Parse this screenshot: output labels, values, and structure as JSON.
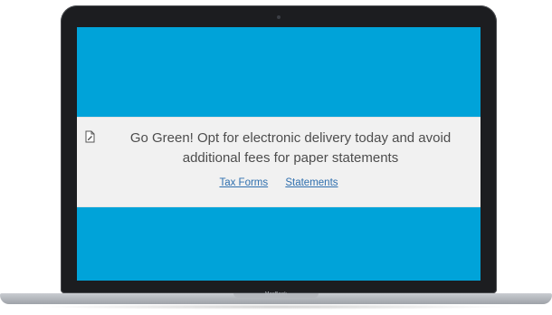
{
  "device": {
    "brand_label": "MacBook"
  },
  "banner": {
    "icon": "document-edit-icon",
    "message": "Go Green! Opt for electronic delivery today and avoid additional fees for paper statements",
    "links": [
      {
        "label": "Tax Forms"
      },
      {
        "label": "Statements"
      }
    ]
  },
  "colors": {
    "screen_background": "#00a3d9",
    "banner_background": "#f1f1f1",
    "link": "#2f6fae",
    "text": "#4d4d4d"
  }
}
